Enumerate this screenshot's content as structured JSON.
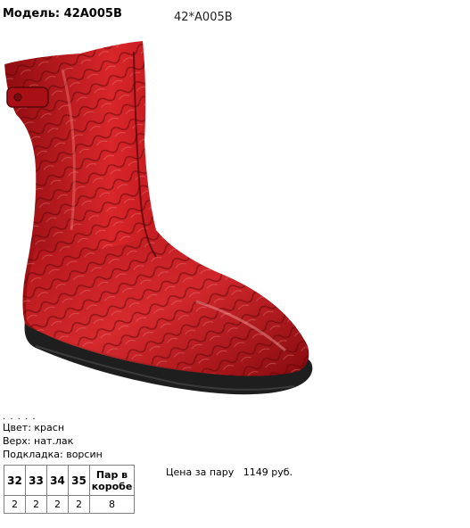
{
  "header": {
    "model_label": "Модель: 42А005В",
    "model_code": "42*А005В"
  },
  "product": {
    "image_alt": "red patent leather boot",
    "colors": {
      "boot_main": "#c8141a",
      "boot_dark": "#6a0a0c",
      "sole": "#1e1e1e"
    }
  },
  "attributes": {
    "dots": ". . . . .",
    "color": "Цвет: красн",
    "upper": "Верх: нат.лак",
    "lining": "Подкладка: ворсин"
  },
  "size_table": {
    "headers": [
      "32",
      "33",
      "34",
      "35",
      "Пар в коробе"
    ],
    "values": [
      "2",
      "2",
      "2",
      "2",
      "8"
    ]
  },
  "price": {
    "label": "Цена за пару",
    "value": "1149 руб."
  }
}
